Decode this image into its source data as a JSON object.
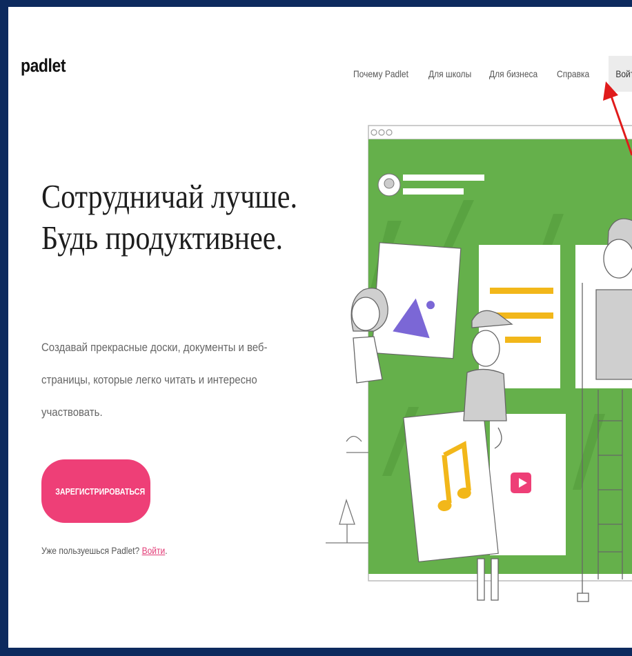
{
  "header": {
    "logo": "padlet",
    "nav": [
      {
        "label": "Почему Padlet"
      },
      {
        "label": "Для школы"
      },
      {
        "label": "Для бизнеса"
      },
      {
        "label": "Справка"
      }
    ],
    "login_label": "Войти"
  },
  "hero": {
    "title_line1": "Сотрудничай лучше.",
    "title_line2": "Будь продуктивнее.",
    "subtitle": "Создавай прекрасные доски, документы и веб-страницы, которые легко читать и интересно участвовать.",
    "signup_label": "ЗАРЕГИСТРИРОВАТЬСЯ",
    "already_text": "Уже пользуешься Padlet? ",
    "already_link": "Войти",
    "already_end": "."
  },
  "colors": {
    "frame": "#0d2a5e",
    "accent": "#ee3f77",
    "board_green": "#65b04b",
    "annotation_arrow": "#e01b1b"
  },
  "icons": [
    "image-icon",
    "text-lines-icon",
    "music-note-icon",
    "video-play-icon",
    "annotation-arrow"
  ]
}
